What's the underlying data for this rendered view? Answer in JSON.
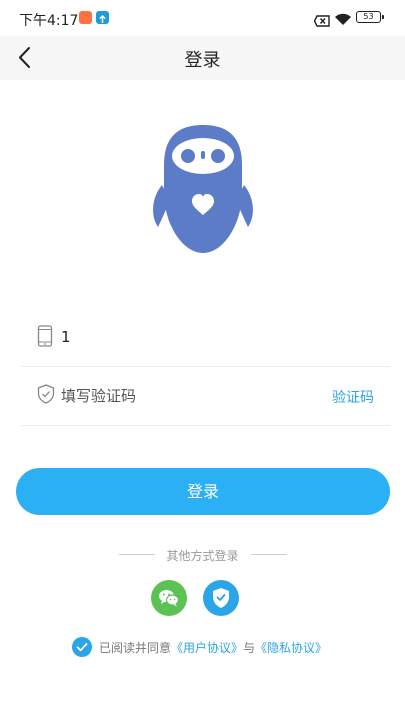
{
  "status_bar": {
    "time": "下午4:17",
    "battery": "53"
  },
  "header": {
    "title": "登录"
  },
  "form": {
    "phone_value": "1",
    "code_placeholder": "填写验证码",
    "get_code_label": "验证码",
    "login_label": "登录"
  },
  "other_login": {
    "label": "其他方式登录"
  },
  "agreement": {
    "prefix": "已阅读并同意",
    "user_agreement": "《用户协议》",
    "connector": "与",
    "privacy_agreement": "《隐私协议》"
  },
  "colors": {
    "accent": "#2bb0f6",
    "link": "#2aa5e8",
    "logo": "#5c7cc7",
    "wechat": "#5bc253"
  },
  "icons": {
    "back": "chevron-left-icon",
    "phone": "phone-icon",
    "shield": "shield-check-icon",
    "wechat": "wechat-icon",
    "security": "shield-check-icon",
    "check": "check-icon"
  }
}
